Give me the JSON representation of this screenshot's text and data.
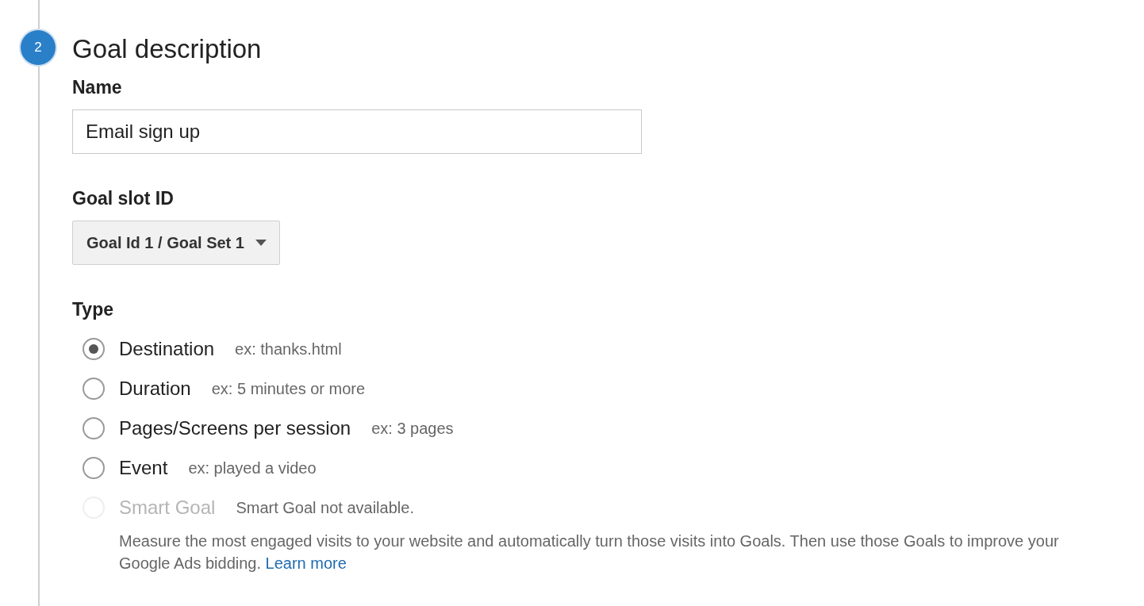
{
  "step": {
    "number": "2",
    "title": "Goal description"
  },
  "name_field": {
    "label": "Name",
    "value": "Email sign up"
  },
  "goal_slot": {
    "label": "Goal slot ID",
    "value": "Goal Id 1 / Goal Set 1"
  },
  "type": {
    "label": "Type",
    "options": [
      {
        "label": "Destination",
        "hint": "ex: thanks.html",
        "selected": true,
        "disabled": false
      },
      {
        "label": "Duration",
        "hint": "ex: 5 minutes or more",
        "selected": false,
        "disabled": false
      },
      {
        "label": "Pages/Screens per session",
        "hint": "ex: 3 pages",
        "selected": false,
        "disabled": false
      },
      {
        "label": "Event",
        "hint": "ex: played a video",
        "selected": false,
        "disabled": false
      },
      {
        "label": "Smart Goal",
        "hint": "Smart Goal not available.",
        "selected": false,
        "disabled": true
      }
    ],
    "note": {
      "text": "Measure the most engaged visits to your website and automatically turn those visits into Goals. Then use those Goals to improve your Google Ads bidding.",
      "link": "Learn more"
    }
  }
}
